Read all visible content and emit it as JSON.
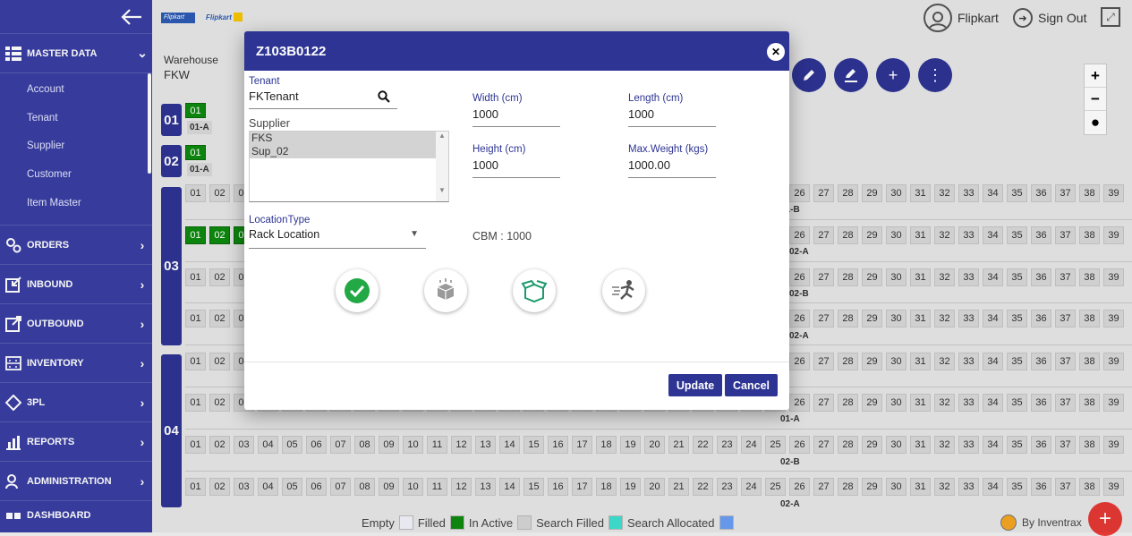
{
  "header": {
    "logo_text": "Flipkart",
    "logo2_text": "Flipkart",
    "user_name": "Flipkart",
    "signout_label": "Sign Out"
  },
  "sidebar": {
    "sections": [
      {
        "label": "MASTER DATA",
        "icon": "grid-list-icon",
        "expanded": true
      },
      {
        "label": "ORDERS",
        "icon": "gears-icon"
      },
      {
        "label": "INBOUND",
        "icon": "inbound-icon"
      },
      {
        "label": "OUTBOUND",
        "icon": "outbound-icon"
      },
      {
        "label": "INVENTORY",
        "icon": "inventory-icon"
      },
      {
        "label": "3PL",
        "icon": "diamond-icon"
      },
      {
        "label": "REPORTS",
        "icon": "bar-chart-icon"
      },
      {
        "label": "ADMINISTRATION",
        "icon": "users-icon"
      },
      {
        "label": "DASHBOARD",
        "icon": "dashboard-icon"
      }
    ],
    "master_items": [
      "Account",
      "Tenant",
      "Supplier",
      "Customer",
      "Item Master"
    ]
  },
  "warehouse": {
    "label": "Warehouse",
    "value": "FKW"
  },
  "grid": {
    "bands": [
      "01",
      "02",
      "03",
      "04"
    ],
    "row_labels": [
      "01-A",
      "01-A",
      "01-B",
      "02-A",
      "02-B",
      "02-A",
      "01-A",
      "02-B",
      "02-A"
    ],
    "columns": [
      "01",
      "02",
      "03",
      "04",
      "05",
      "06",
      "07",
      "08",
      "09",
      "10",
      "11",
      "12",
      "13",
      "14",
      "15",
      "16",
      "17",
      "18",
      "19",
      "20",
      "21",
      "22",
      "23",
      "24",
      "25",
      "26",
      "27",
      "28",
      "29",
      "30",
      "31",
      "32",
      "33",
      "34",
      "35",
      "36",
      "37",
      "38",
      "39"
    ]
  },
  "legend": {
    "items": [
      {
        "label": "Empty",
        "color": "#f2f2fa"
      },
      {
        "label": "Filled",
        "color": "#0e8a0e"
      },
      {
        "label": "In Active",
        "color": "#d6d6d6"
      },
      {
        "label": "Search Filled",
        "color": "#40e0d0"
      },
      {
        "label": "Search Allocated",
        "color": "#6a9ef5"
      }
    ],
    "by_label": "By Inventrax"
  },
  "modal": {
    "title": "Z103B0122",
    "tenant_label": "Tenant",
    "tenant_value": "FKTenant",
    "supplier_label": "Supplier",
    "suppliers": [
      "FKS",
      "Sup_02"
    ],
    "width_label": "Width (cm)",
    "width_value": "1000",
    "length_label": "Length (cm)",
    "length_value": "1000",
    "height_label": "Height (cm)",
    "height_value": "1000",
    "maxweight_label": "Max.Weight (kgs)",
    "maxweight_value": "1000.00",
    "location_type_label": "LocationType",
    "location_type_value": "Rack Location",
    "cbm_text": "CBM : 1000",
    "update_label": "Update",
    "cancel_label": "Cancel"
  },
  "colors": {
    "primary": "#2d3493",
    "sidebar": "#3a3fa3",
    "filled": "#0e8a0e",
    "fab": "#e53935"
  }
}
